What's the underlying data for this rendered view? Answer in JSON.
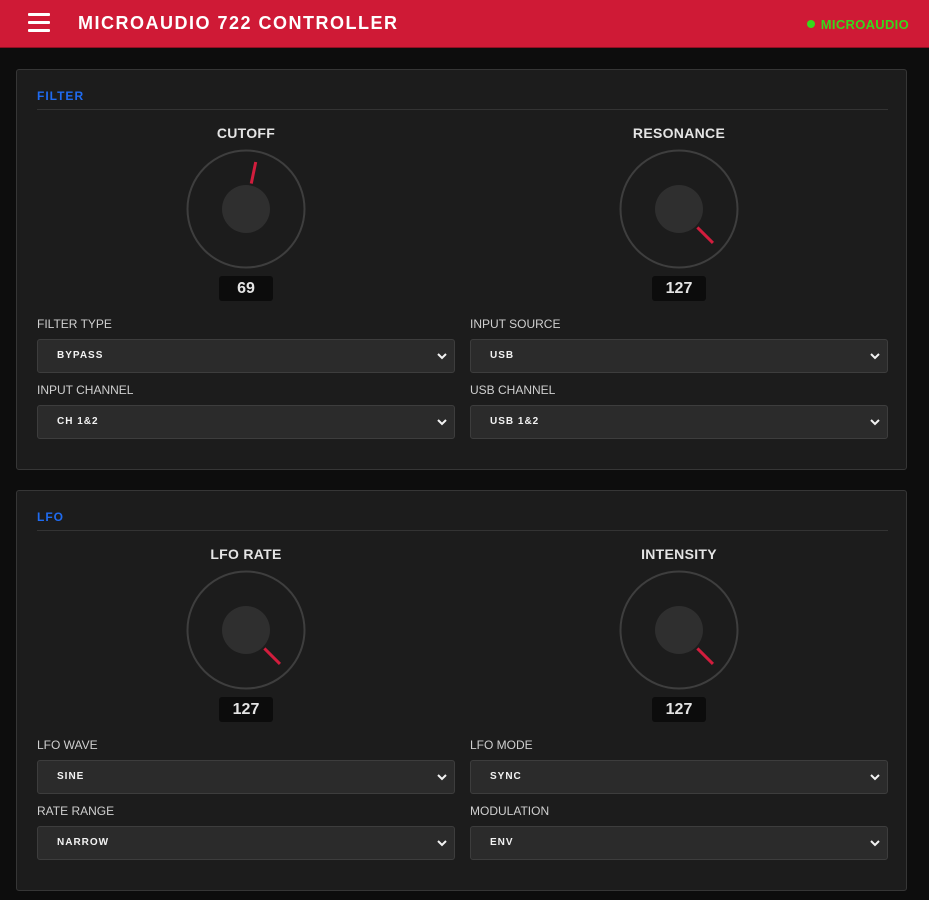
{
  "header": {
    "title": "MICROAUDIO 722 CONTROLLER",
    "menu_icon": "hamburger-menu-icon",
    "status": {
      "label": "MICROAUDIO",
      "connected": true,
      "color": "#37d81b"
    },
    "background": "#cf1a36"
  },
  "accent_color": "#1f6bf0",
  "knob_indicator_color": "#d21d3d",
  "filter": {
    "title": "FILTER",
    "cutoff": {
      "label": "CUTOFF",
      "value": "69",
      "level": 69
    },
    "resonance": {
      "label": "RESONANCE",
      "value": "127",
      "level": 127
    },
    "filter_type": {
      "label": "FILTER TYPE",
      "value": "BYPASS"
    },
    "input_source": {
      "label": "INPUT SOURCE",
      "value": "USB"
    },
    "input_channel": {
      "label": "INPUT CHANNEL",
      "value": "CH 1&2"
    },
    "usb_channel": {
      "label": "USB CHANNEL",
      "value": "USB 1&2"
    }
  },
  "lfo": {
    "title": "LFO",
    "rate": {
      "label": "LFO RATE",
      "value": "127",
      "level": 127
    },
    "intensity": {
      "label": "INTENSITY",
      "value": "127",
      "level": 127
    },
    "wave": {
      "label": "LFO WAVE",
      "value": "SINE"
    },
    "mode": {
      "label": "LFO MODE",
      "value": "SYNC"
    },
    "rate_range": {
      "label": "RATE RANGE",
      "value": "NARROW"
    },
    "modulation": {
      "label": "MODULATION",
      "value": "ENV"
    }
  }
}
